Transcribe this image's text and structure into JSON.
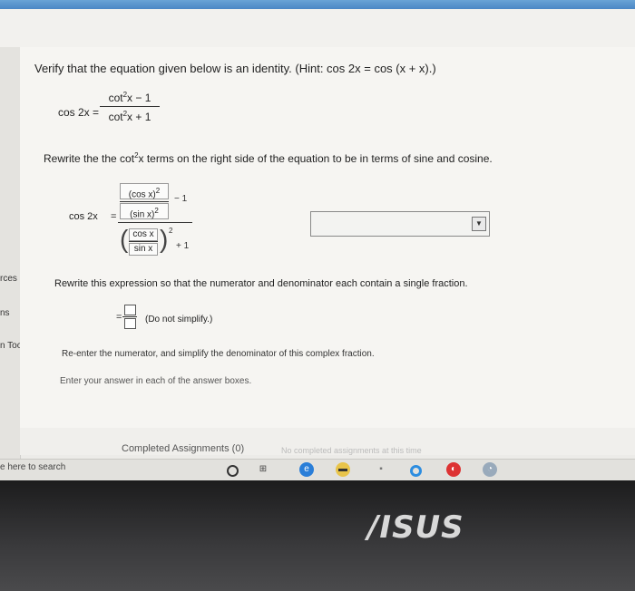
{
  "side_labels": [
    "rces",
    "ns",
    "n Tools"
  ],
  "question": {
    "heading": "Verify that the equation given below is an identity. (Hint: cos 2x = cos (x + x).)",
    "equation_lhs": "cos 2x =",
    "frac_num_pre": "cot",
    "frac_num_post": "x − 1",
    "frac_den_pre": "cot",
    "frac_den_post": "x + 1",
    "exp": "2"
  },
  "step1": {
    "instruction_pre": "Rewrite the the cot",
    "instruction_post": "x terms on the right side of the equation to be in terms of sine and cosine.",
    "lhs": "cos 2x",
    "eq": "=",
    "num_top": "(cos x)",
    "num_bot": "(sin x)",
    "minus1": "− 1",
    "den_top": "cos x",
    "den_bot": "sin x",
    "plus1": "+ 1",
    "exp": "2",
    "dropdown_value": ""
  },
  "step2": {
    "instruction": "Rewrite this expression so that the numerator and denominator each contain a single fraction.",
    "eq": "=",
    "note": "(Do not simplify.)"
  },
  "step3": {
    "instruction": "Re-enter the numerator, and simplify the denominator of this complex fraction.",
    "help": "Enter your answer in each of the answer boxes."
  },
  "footer": {
    "completed": "Completed Assignments (0)",
    "faded_text": "No completed assignments at this time"
  },
  "taskbar": {
    "search_hint": "e here to search"
  },
  "brand": "/ISUS"
}
